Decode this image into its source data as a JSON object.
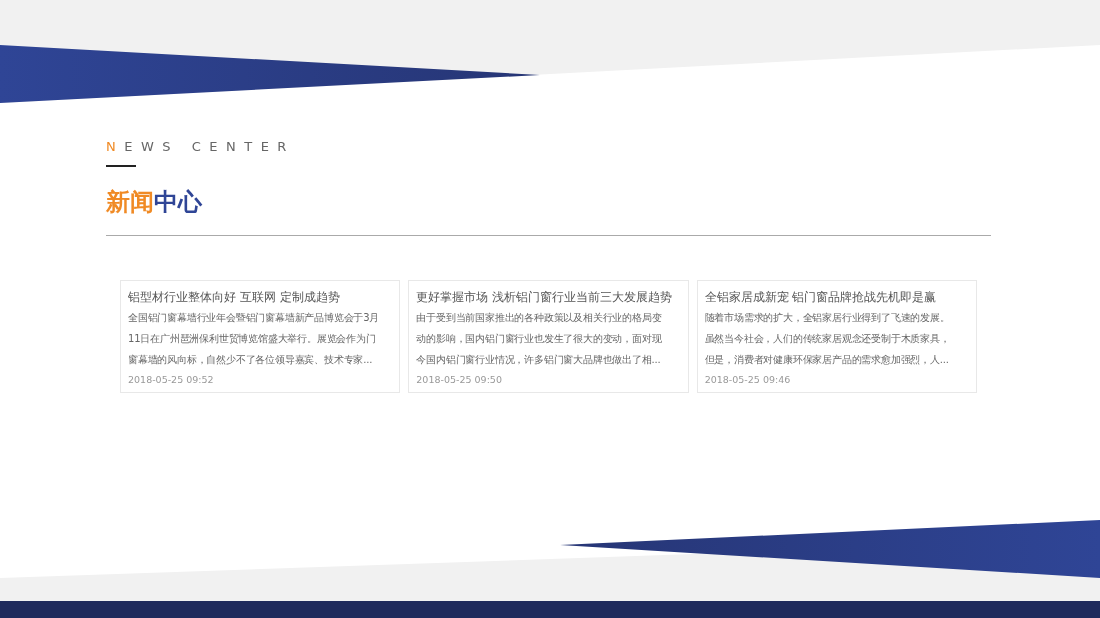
{
  "heading": {
    "initial": "N",
    "rest": "EWS CENTER"
  },
  "title": {
    "accent": "新闻",
    "main": "中心"
  },
  "news": [
    {
      "title": "铝型材行业整体向好 互联网 定制成趋势",
      "excerpt": [
        "全国铝门窗幕墙行业年会暨铝门窗幕墙新产品博览会于3月",
        "11日在广州琶洲保利世贸博览馆盛大举行。展览会作为门",
        "窗幕墙的风向标，自然少不了各位领导嘉宾、技术专家..."
      ],
      "date": "2018-05-25 09:52"
    },
    {
      "title": "更好掌握市场 浅析铝门窗行业当前三大发展趋势",
      "excerpt": [
        "由于受到当前国家推出的各种政策以及相关行业的格局变",
        "动的影响，国内铝门窗行业也发生了很大的变动，面对现",
        "今国内铝门窗行业情况，许多铝门窗大品牌也做出了相..."
      ],
      "date": "2018-05-25 09:50"
    },
    {
      "title": "全铝家居成新宠 铝门窗品牌抢战先机即是赢",
      "excerpt": [
        "随着市场需求的扩大，全铝家居行业得到了飞速的发展。",
        "虽然当今社会，人们的传统家居观念还受制于木质家具，",
        "但是，消费者对健康环保家居产品的需求愈加强烈，人..."
      ],
      "date": "2018-05-25 09:46"
    }
  ]
}
